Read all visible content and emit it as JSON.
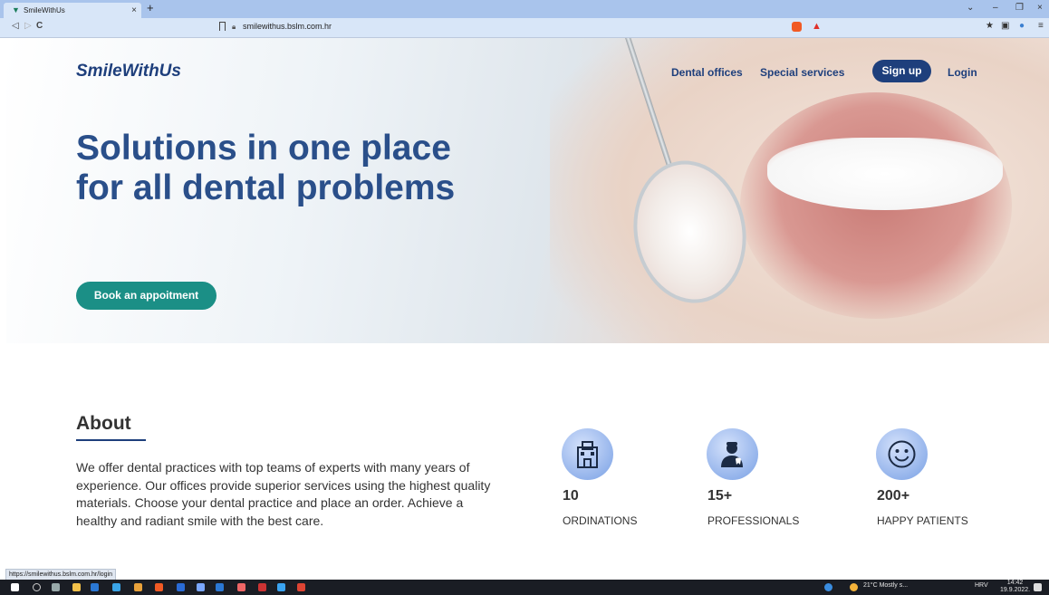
{
  "browser": {
    "tab_title": "SmileWithUs",
    "tab_close": "×",
    "new_tab": "+",
    "url": "smilewithus.bslm.com.hr",
    "nav_back": "◁",
    "nav_forward": "▷",
    "nav_reload": "C",
    "window_minimize": "–",
    "window_restore": "❐",
    "window_close": "×",
    "tab_menu": "⌄",
    "menu": "≡",
    "status_url": "https://smilewithus.bslm.com.hr/login"
  },
  "site": {
    "brand": "SmileWithUs",
    "nav": {
      "dental_offices": "Dental offices",
      "special_services": "Special services",
      "sign_up": "Sign up",
      "login": "Login"
    },
    "hero": {
      "title": "Solutions in one place for all dental problems",
      "cta": "Book an appoitment"
    },
    "about": {
      "title": "About",
      "text": "We offer dental practices with top teams of experts with many years of experience. Our offices provide superior services using the highest quality materials. Choose your dental practice and place an order. Achieve a healthy and radiant smile with the best care."
    },
    "stats": [
      {
        "value": "10",
        "label": "ORDINATIONS",
        "icon": "hospital-icon"
      },
      {
        "value": "15+",
        "label": "PROFESSIONALS",
        "icon": "dentist-icon"
      },
      {
        "value": "200+",
        "label": "HAPPY PATIENTS",
        "icon": "smiley-icon"
      }
    ]
  },
  "taskbar": {
    "weather": "21°C Mostly s...",
    "language": "HRV",
    "time": "14:42",
    "date": "19.9.2022."
  },
  "colors": {
    "brand_blue": "#1e3f7c",
    "cta_teal": "#1b8f86",
    "icon_blue": "#8fb0ea"
  }
}
